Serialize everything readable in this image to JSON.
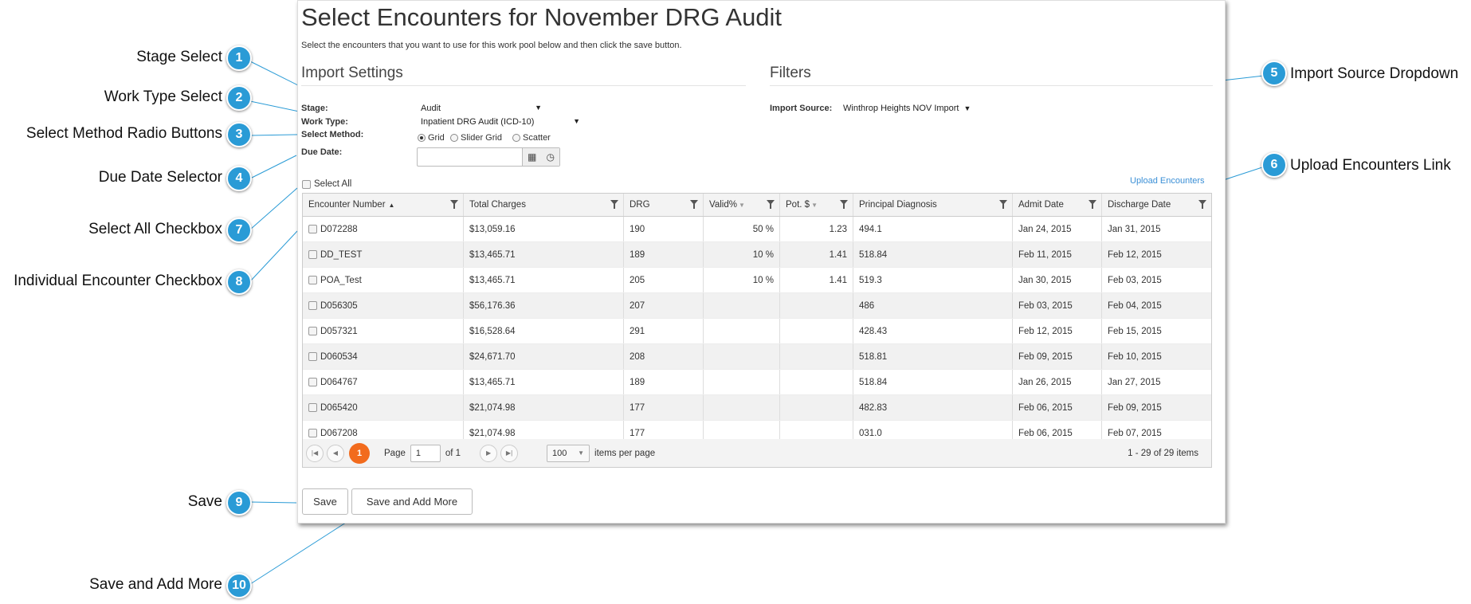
{
  "page": {
    "title": "Select Encounters for November DRG Audit",
    "subtitle": "Select the encounters that you want to use for this work pool below and then click the save button."
  },
  "import_settings": {
    "heading": "Import Settings",
    "stage_label": "Stage:",
    "stage_value": "Audit",
    "work_type_label": "Work Type:",
    "work_type_value": "Inpatient DRG Audit (ICD-10)",
    "select_method_label": "Select Method:",
    "methods": [
      "Grid",
      "Slider Grid",
      "Scatter"
    ],
    "selected_method": "Grid",
    "due_date_label": "Due Date:",
    "due_date_value": ""
  },
  "filters": {
    "heading": "Filters",
    "import_source_label": "Import Source:",
    "import_source_value": "Winthrop Heights NOV Import"
  },
  "upload_link": "Upload Encounters",
  "select_all_label": "Select All",
  "grid": {
    "columns": [
      "Encounter Number",
      "Total Charges",
      "DRG",
      "Valid%",
      "Pot. $",
      "Principal Diagnosis",
      "Admit Date",
      "Discharge Date"
    ],
    "rows": [
      [
        "D072288",
        "$13,059.16",
        "190",
        "50 %",
        "1.23",
        "494.1",
        "Jan 24, 2015",
        "Jan 31, 2015"
      ],
      [
        "DD_TEST",
        "$13,465.71",
        "189",
        "10 %",
        "1.41",
        "518.84",
        "Feb 11, 2015",
        "Feb 12, 2015"
      ],
      [
        "POA_Test",
        "$13,465.71",
        "205",
        "10 %",
        "1.41",
        "519.3",
        "Jan 30, 2015",
        "Feb 03, 2015"
      ],
      [
        "D056305",
        "$56,176.36",
        "207",
        "",
        "",
        "486",
        "Feb 03, 2015",
        "Feb 04, 2015"
      ],
      [
        "D057321",
        "$16,528.64",
        "291",
        "",
        "",
        "428.43",
        "Feb 12, 2015",
        "Feb 15, 2015"
      ],
      [
        "D060534",
        "$24,671.70",
        "208",
        "",
        "",
        "518.81",
        "Feb 09, 2015",
        "Feb 10, 2015"
      ],
      [
        "D064767",
        "$13,465.71",
        "189",
        "",
        "",
        "518.84",
        "Jan 26, 2015",
        "Jan 27, 2015"
      ],
      [
        "D065420",
        "$21,074.98",
        "177",
        "",
        "",
        "482.83",
        "Feb 06, 2015",
        "Feb 09, 2015"
      ],
      [
        "D067208",
        "$21,074.98",
        "177",
        "",
        "",
        "031.0",
        "Feb 06, 2015",
        "Feb 07, 2015"
      ]
    ]
  },
  "pager": {
    "current_page": "1",
    "page_label": "Page",
    "page_input": "1",
    "of_label": "of 1",
    "page_size": "100",
    "items_per_page_label": "items per page",
    "summary": "1 - 29 of 29 items"
  },
  "buttons": {
    "save": "Save",
    "save_add_more": "Save and Add More"
  },
  "callouts": [
    {
      "num": "1",
      "label": "Stage Select"
    },
    {
      "num": "2",
      "label": "Work Type Select"
    },
    {
      "num": "3",
      "label": "Select Method Radio Buttons"
    },
    {
      "num": "4",
      "label": "Due Date Selector"
    },
    {
      "num": "5",
      "label": "Import Source Dropdown"
    },
    {
      "num": "6",
      "label": "Upload Encounters Link"
    },
    {
      "num": "7",
      "label": "Select All Checkbox"
    },
    {
      "num": "8",
      "label": "Individual Encounter Checkbox"
    },
    {
      "num": "9",
      "label": "Save"
    },
    {
      "num": "10",
      "label": "Save and Add More"
    }
  ],
  "colors": {
    "badge": "#2a9bd6",
    "link": "#3a8fd6",
    "current_page": "#f26b1d"
  }
}
